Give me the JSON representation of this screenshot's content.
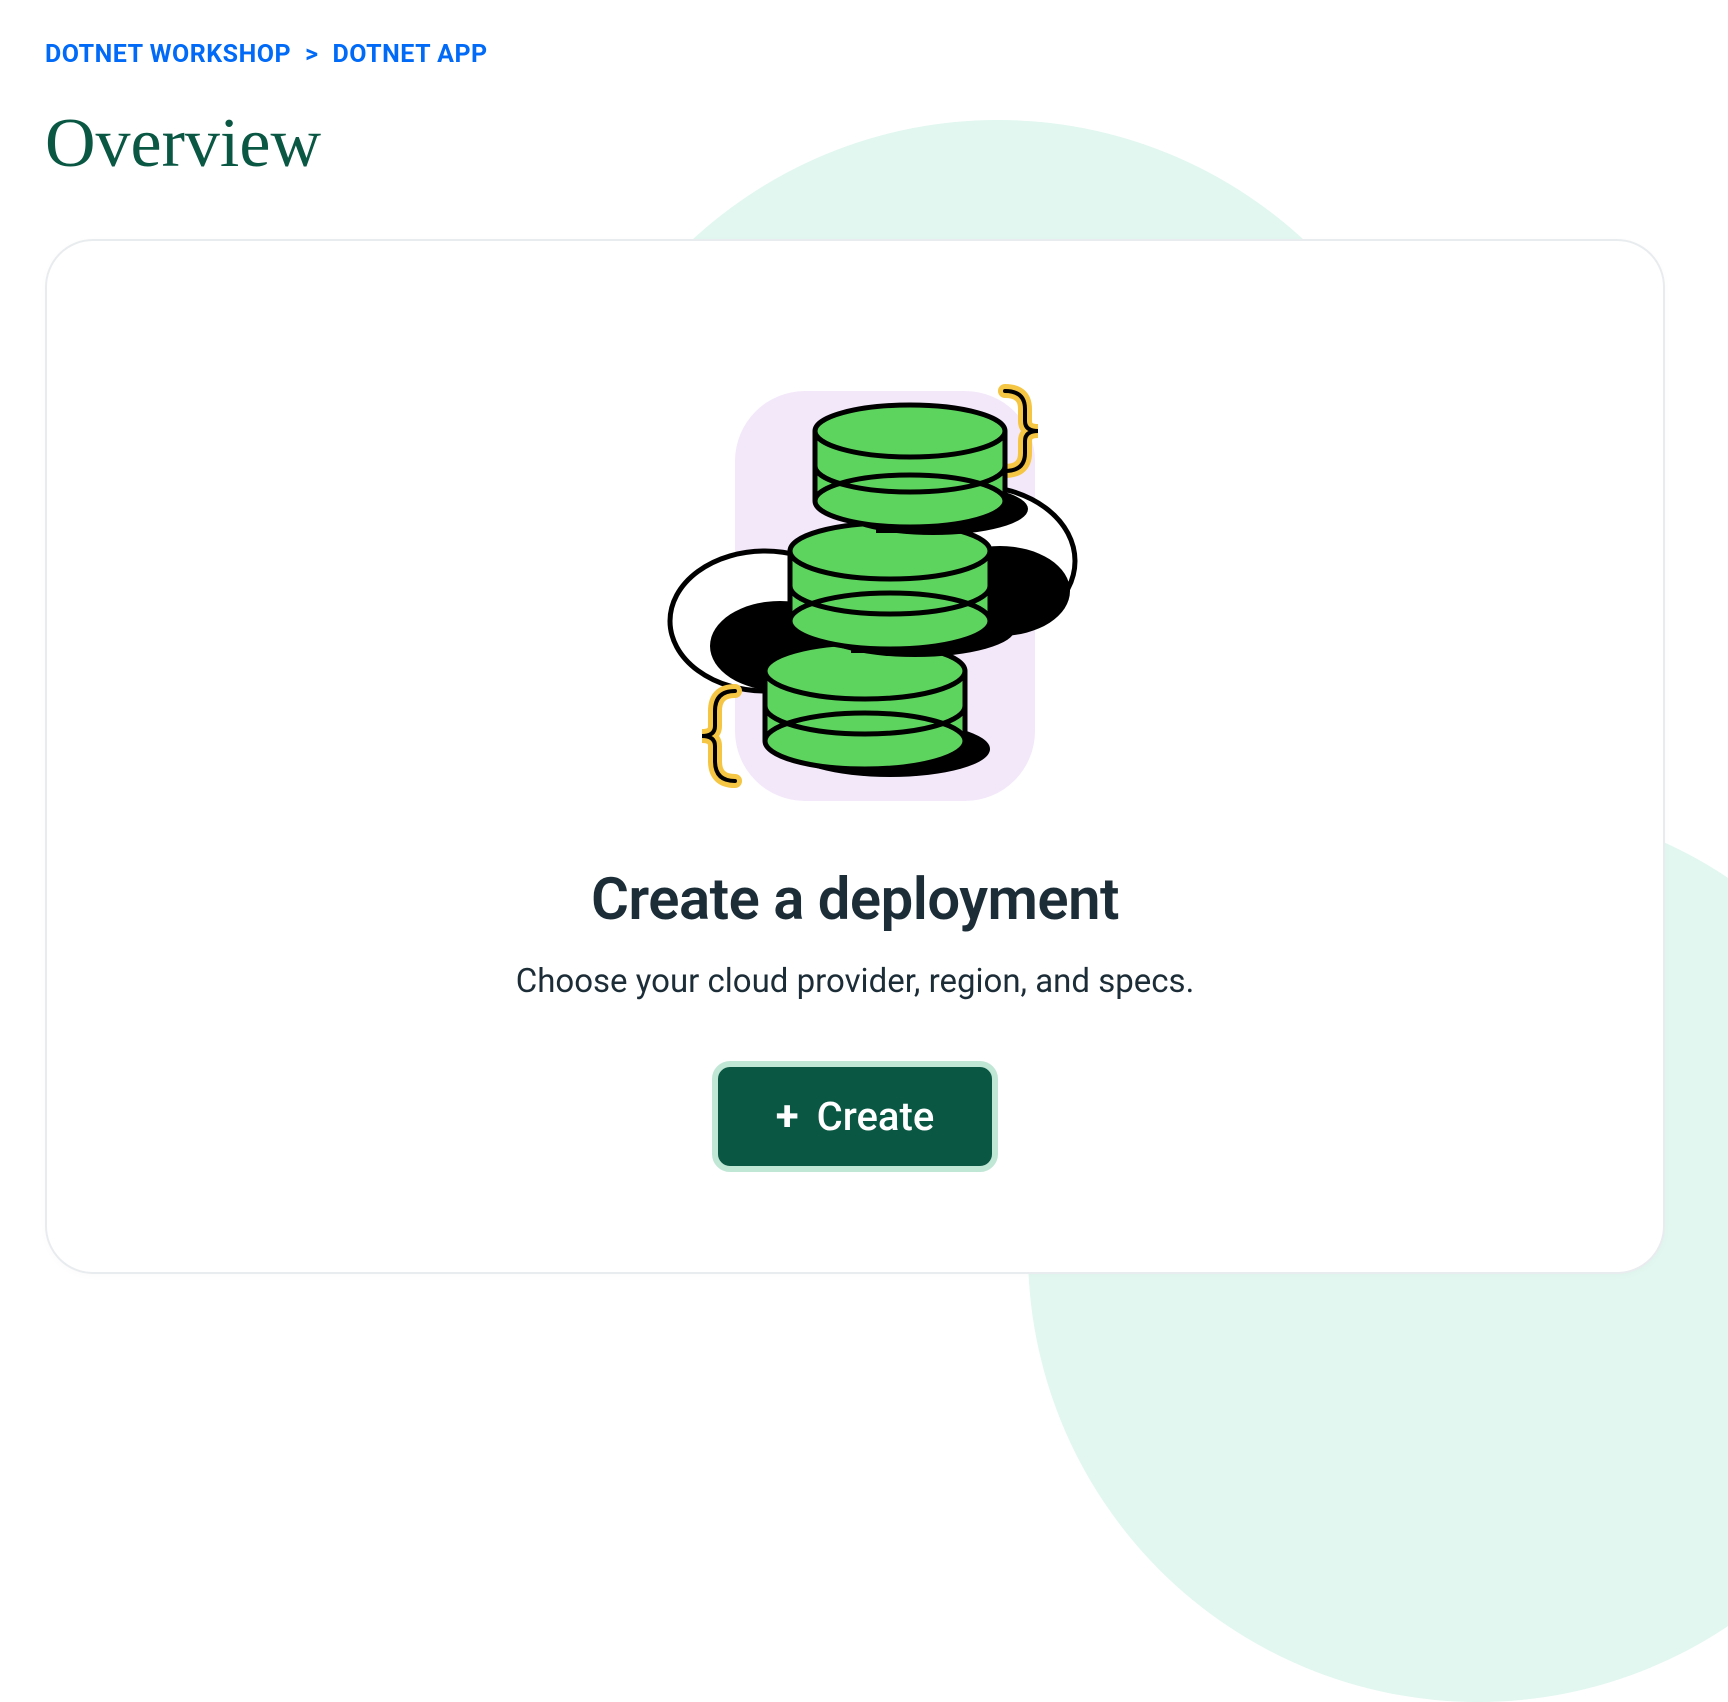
{
  "breadcrumb": {
    "parent": "DOTNET WORKSHOP",
    "separator": ">",
    "current": "DOTNET APP"
  },
  "page": {
    "title": "Overview"
  },
  "empty_state": {
    "title": "Create a deployment",
    "subtitle": "Choose your cloud provider, region, and specs.",
    "button_label": "Create",
    "illustration": "database-cloud-stack-icon"
  },
  "colors": {
    "link": "#016BF8",
    "heading": "#0a5743",
    "text": "#1c2d38",
    "button_bg": "#0a5743",
    "button_border": "#c0e6d6",
    "accent_bg": "#e1f7ef"
  }
}
